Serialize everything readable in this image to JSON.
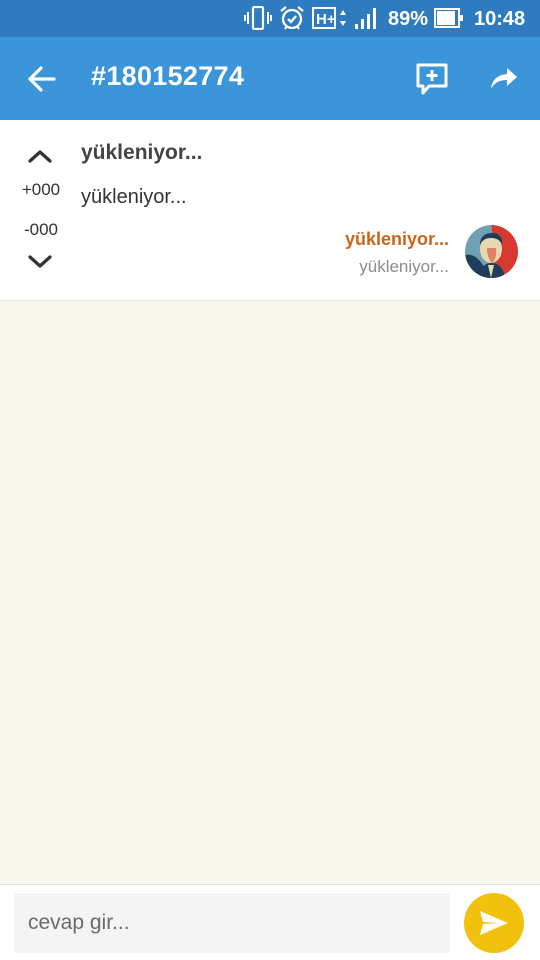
{
  "status_bar": {
    "battery_percent": "89%",
    "time": "10:48",
    "network": "H+",
    "icons": [
      "vibrate-icon",
      "alarm-icon",
      "network-h-plus-icon",
      "signal-icon",
      "battery-icon"
    ]
  },
  "app_bar": {
    "title": "#180152774",
    "back_icon": "arrow-left-icon",
    "add_comment_icon": "comment-plus-icon",
    "share_icon": "share-icon"
  },
  "entry": {
    "title": "yükleniyor...",
    "body": "yükleniyor...",
    "author": "yükleniyor...",
    "date": "yükleniyor...",
    "vote_plus": "+000",
    "vote_minus": "-000"
  },
  "reply": {
    "placeholder": "cevap gir..."
  },
  "colors": {
    "status_bar": "#2e7bbf",
    "app_bar": "#3c95d8",
    "author": "#c7661a",
    "send_button": "#f2c10d",
    "background": "#f9f8ef"
  }
}
